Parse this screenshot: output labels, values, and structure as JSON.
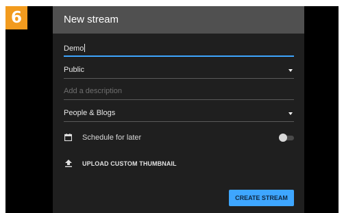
{
  "step_badge": "6",
  "dialog": {
    "title": "New stream",
    "fields": {
      "title_value": "Demo",
      "visibility": "Public",
      "description_placeholder": "Add a description",
      "category": "People & Blogs"
    },
    "schedule": {
      "label": "Schedule for later",
      "enabled": false
    },
    "upload_thumbnail_label": "UPLOAD CUSTOM THUMBNAIL",
    "create_button_label": "CREATE STREAM"
  },
  "colors": {
    "badge": "#f29b1e",
    "accent": "#3ea6ff",
    "panel": "#1f1f1f",
    "header": "#505050"
  }
}
